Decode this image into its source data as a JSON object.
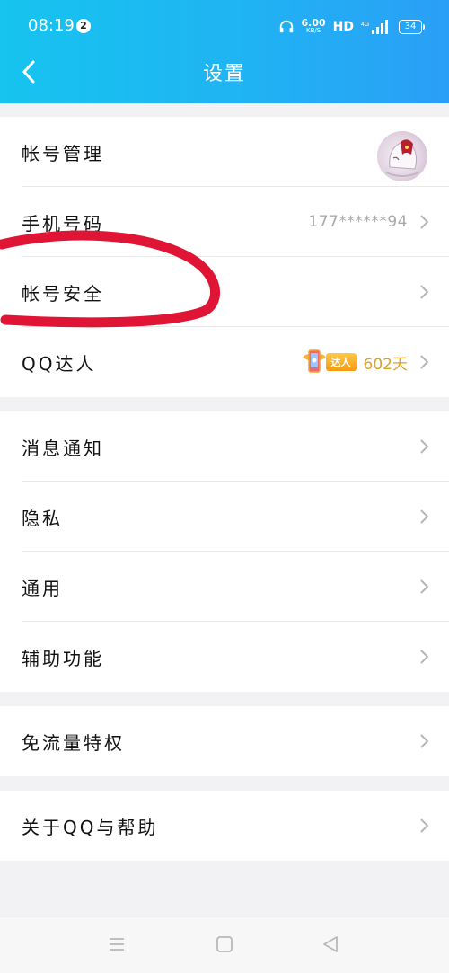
{
  "status_bar": {
    "time": "08:19",
    "notification_count": "2",
    "speed_value": "6.00",
    "speed_unit": "KB/S",
    "hd_label": "HD",
    "network": "4G",
    "battery": "34"
  },
  "header": {
    "title": "设置"
  },
  "groups": [
    {
      "items": [
        {
          "label": "帐号管理"
        },
        {
          "label": "手机号码",
          "value": "177******94"
        },
        {
          "label": "帐号安全"
        },
        {
          "label": "QQ达人",
          "badge_text": "达人",
          "days": "602天"
        }
      ]
    },
    {
      "items": [
        {
          "label": "消息通知"
        },
        {
          "label": "隐私"
        },
        {
          "label": "通用"
        },
        {
          "label": "辅助功能"
        }
      ]
    },
    {
      "items": [
        {
          "label": "免流量特权"
        }
      ]
    },
    {
      "items": [
        {
          "label": "关于QQ与帮助"
        }
      ]
    }
  ],
  "colors": {
    "header_start": "#16c4ef",
    "header_end": "#2a9ff7",
    "annotation_red": "#e01535",
    "daren_days": "#d9a226"
  },
  "icons": {
    "back": "chevron-left-icon",
    "row_arrow": "chevron-right-icon",
    "nav_menu": "menu-icon",
    "nav_home": "square-icon",
    "nav_back": "triangle-back-icon"
  }
}
